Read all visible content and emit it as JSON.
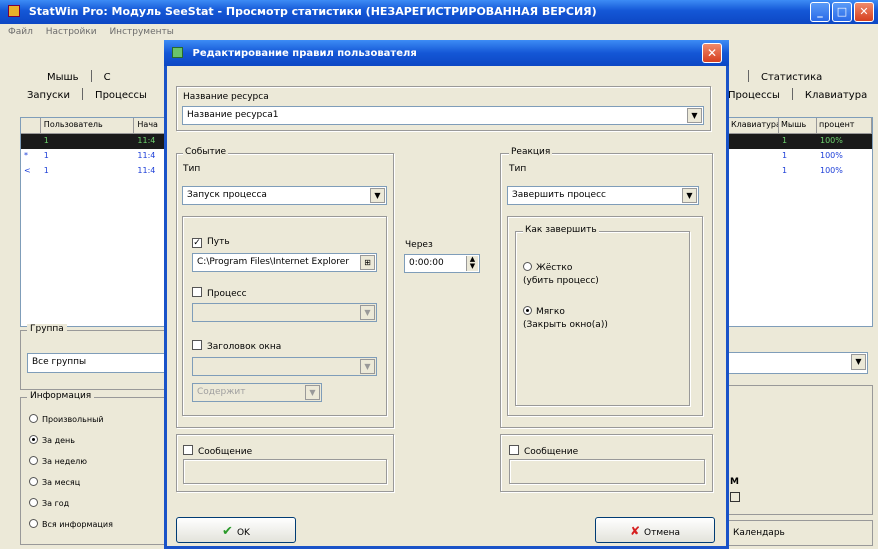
{
  "main_window": {
    "title": "StatWin Pro: Модуль SeeStat - Просмотр статистики (НЕЗАРЕГИСТРИРОВАННАЯ ВЕРСИЯ)",
    "menu": [
      "Файл",
      "Настройки",
      "Инструменты"
    ],
    "tabs_left_row1": [
      "Мышь",
      "С"
    ],
    "tabs_left_row2": [
      "Запуски",
      "Процессы"
    ],
    "tabs_right_row1": [
      "Статистика"
    ],
    "tabs_right_row2": [
      "Процессы",
      "Клавиатура"
    ],
    "grid_left": {
      "columns": [
        "",
        "Пользователь",
        "Нача"
      ],
      "rows": [
        {
          "indicator": "",
          "user": "1",
          "time": "11:4"
        },
        {
          "indicator": "*",
          "user": "1",
          "time": "11:4"
        },
        {
          "indicator": "<",
          "user": "1",
          "time": "11:4"
        }
      ]
    },
    "grid_right": {
      "columns": [
        "Клавиатура",
        "Мышь",
        "процент"
      ],
      "rows": [
        {
          "a": "",
          "b": "1",
          "c": "100%"
        },
        {
          "a": "",
          "b": "1",
          "c": "100%"
        },
        {
          "a": "",
          "b": "1",
          "c": "100%"
        }
      ]
    },
    "group_label": "Группа",
    "group_value": "Все группы",
    "detail_label": "Информация",
    "detail_options": [
      "Произвольный",
      "За день",
      "За неделю",
      "За месяц",
      "За год",
      "Вся информация"
    ],
    "detail_selected": 1,
    "right_mark": "М",
    "right_button": "Календарь"
  },
  "dialog": {
    "title": "Редактирование правил пользователя",
    "resource_label": "Название ресурса",
    "resource_value": "Название ресурса1",
    "event": {
      "legend": "Событие",
      "type_label": "Тип",
      "type_value": "Запуск процесса",
      "path_label": "Путь",
      "path_checked": true,
      "path_value": "C:\\Program Files\\Internet Explorer",
      "process_label": "Процесс",
      "window_title_label": "Заголовок окна",
      "match_value": "Содержит",
      "message_label": "Сообщение"
    },
    "delay": {
      "label": "Через",
      "value": "0:00:00"
    },
    "reaction": {
      "legend": "Реакция",
      "type_label": "Тип",
      "type_value": "Завершить процесс",
      "how_legend": "Как завершить",
      "hard_label": "Жёстко",
      "hard_desc": "(убить процесс)",
      "soft_label": "Мягко",
      "soft_desc": "(Закрыть окно(а))",
      "selected": "soft",
      "message_label": "Сообщение"
    },
    "ok_label": "OK",
    "cancel_label": "Отмена",
    "colors": {
      "titlebar": "#1457d6",
      "ok_icon": "#2a9a2a",
      "cancel_icon": "#d62020"
    }
  }
}
